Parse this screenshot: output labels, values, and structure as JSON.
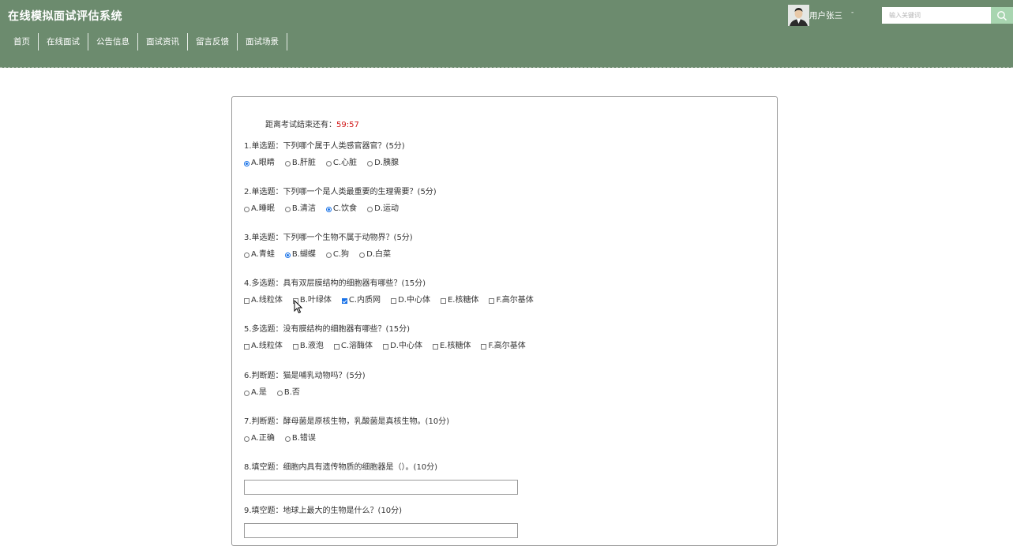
{
  "site_title": "在线模拟面试评估系统",
  "nav": [
    "首页",
    "在线面试",
    "公告信息",
    "面试资讯",
    "留言反馈",
    "面试场景"
  ],
  "user": {
    "name": "用户张三",
    "caret": "-"
  },
  "search": {
    "placeholder": "输入关键词"
  },
  "colors": {
    "header_bg": "#6c8b6e",
    "accent": "#a8d5b0",
    "timer": "#d11515",
    "checked": "#1a73e8"
  },
  "exam": {
    "timer_label": "距离考试结束还有：",
    "timer_value": "59:57",
    "questions": [
      {
        "title": "1.单选题：下列哪个属于人类感官器官？(5分)",
        "type": "radio",
        "options": [
          "A.眼睛",
          "B.肝脏",
          "C.心脏",
          "D.胰腺"
        ],
        "selected": [
          0
        ]
      },
      {
        "title": "2.单选题：下列哪一个是人类最重要的生理需要？(5分)",
        "type": "radio",
        "options": [
          "A.睡眠",
          "B.清洁",
          "C.饮食",
          "D.运动"
        ],
        "selected": [
          2
        ]
      },
      {
        "title": "3.单选题：下列哪一个生物不属于动物界？(5分)",
        "type": "radio",
        "options": [
          "A.青蛙",
          "B.蝴蝶",
          "C.狗",
          "D.白菜"
        ],
        "selected": [
          1
        ]
      },
      {
        "title": "4.多选题：具有双层膜结构的细胞器有哪些？(15分)",
        "type": "checkbox",
        "options": [
          "A.线粒体",
          "B.叶绿体",
          "C.内质网",
          "D.中心体",
          "E.核糖体",
          "F.高尔基体"
        ],
        "selected": [
          2
        ]
      },
      {
        "title": "5.多选题：没有膜结构的细胞器有哪些？(15分)",
        "type": "checkbox",
        "options": [
          "A.线粒体",
          "B.液泡",
          "C.溶酶体",
          "D.中心体",
          "E.核糖体",
          "F.高尔基体"
        ],
        "selected": []
      },
      {
        "title": "6.判断题：猫是哺乳动物吗？(5分)",
        "type": "radio",
        "options": [
          "A.是",
          "B.否"
        ],
        "selected": []
      },
      {
        "title": "7.判断题：酵母菌是原核生物，乳酸菌是真核生物。(10分)",
        "type": "radio",
        "options": [
          "A.正确",
          "B.错误"
        ],
        "selected": []
      },
      {
        "title": "8.填空题：细胞内具有遗传物质的细胞器是（）。(10分)",
        "type": "text",
        "value": ""
      },
      {
        "title": "9.填空题：地球上最大的生物是什么？(10分)",
        "type": "text",
        "value": ""
      }
    ]
  }
}
